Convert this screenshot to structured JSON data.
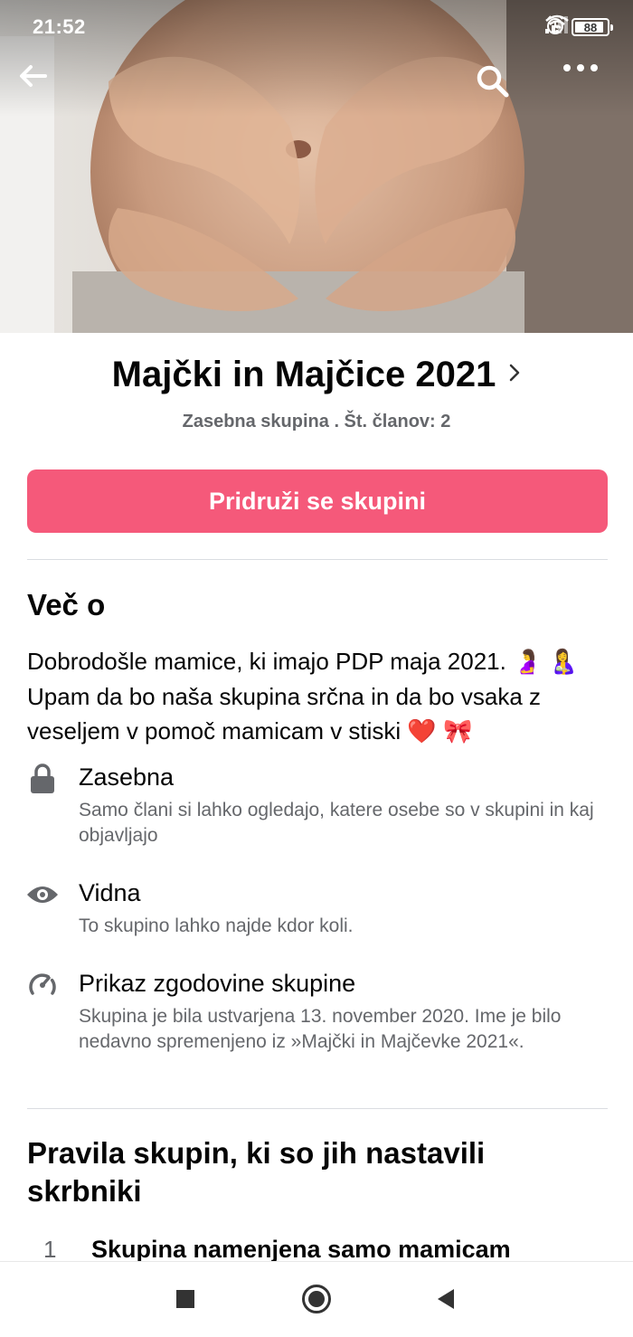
{
  "status_bar": {
    "time": "21:52",
    "battery": "88",
    "icons": [
      "alarm-icon",
      "signal-icon",
      "wifi-icon",
      "battery-icon"
    ]
  },
  "top_bar": {
    "back_icon": "arrow-left-icon",
    "search_icon": "search-icon",
    "more_icon": "more-horizontal-icon"
  },
  "group": {
    "title": "Majčki in Majčice 2021",
    "subtitle": "Zasebna skupina . Št. članov: 2",
    "join_label": "Pridruži se skupini",
    "accent_color": "#f5597a"
  },
  "about": {
    "title": "Več o",
    "description_part1": "Dobrodošle mamice, ki imajo PDP maja 2021. ",
    "description_part2": " Upam da bo naša skupina srčna in da bo vsaka z veseljem v pomoč mamicam v stiski ",
    "emoji_pregnant": "🤰",
    "emoji_breastfeeding": "🤱",
    "emoji_heart": "❤️",
    "emoji_ribbon": "🎀",
    "items": [
      {
        "icon": "lock-icon",
        "title": "Zasebna",
        "desc": "Samo člani si lahko ogledajo, katere osebe so v skupini in kaj objavljajo"
      },
      {
        "icon": "eye-icon",
        "title": "Vidna",
        "desc": "To skupino lahko najde kdor koli."
      },
      {
        "icon": "history-icon",
        "title": "Prikaz zgodovine skupine",
        "desc": "Skupina je bila ustvarjena 13. november 2020. Ime je bilo nedavno spremenjeno iz »Majčki in Majčevke 2021«."
      }
    ]
  },
  "rules": {
    "title": "Pravila skupin, ki so jih nastavili skrbniki",
    "items": [
      {
        "number": "1",
        "text": "Skupina namenjena samo mamicam"
      }
    ]
  },
  "nav_bar": {
    "icons": [
      "recents-square-icon",
      "home-circle-icon",
      "back-triangle-icon"
    ]
  }
}
